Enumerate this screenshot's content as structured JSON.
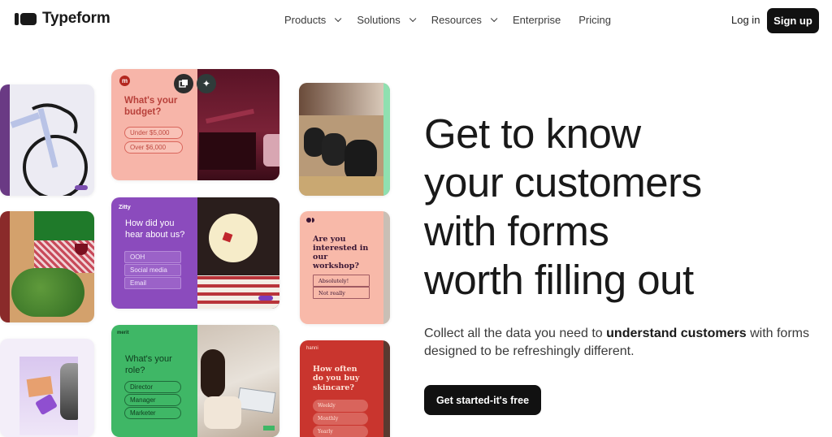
{
  "nav": {
    "brand": "Typeform",
    "menu": [
      {
        "label": "Products",
        "dropdown": true
      },
      {
        "label": "Solutions",
        "dropdown": true
      },
      {
        "label": "Resources",
        "dropdown": true
      },
      {
        "label": "Enterprise",
        "dropdown": false
      },
      {
        "label": "Pricing",
        "dropdown": false
      }
    ],
    "login": "Log in",
    "signup": "Sign up"
  },
  "hero": {
    "headline_lines": [
      "Get to know",
      "your customers",
      "with forms",
      "worth filling out"
    ],
    "sub_pre": "Collect all the data you need to ",
    "sub_bold": "understand customers",
    "sub_post": " with forms designed to be refreshingly different.",
    "cta": "Get started-it's free"
  },
  "cards": {
    "budget": {
      "brand_initial": "m",
      "question": "What's your budget?",
      "options": [
        "Under $5,000",
        "Over $6,000"
      ],
      "colors": {
        "bg": "#f7b5a9",
        "text": "#b8403a",
        "image": "#6e1a2c"
      }
    },
    "zitty": {
      "brand": "Zitty",
      "question": "How did you hear about us?",
      "options": [
        "OOH",
        "Social media",
        "Email"
      ],
      "colors": {
        "bg": "#8b4bbd",
        "text": "#ffffff"
      }
    },
    "merit": {
      "brand": "merit",
      "question": "What's your role?",
      "options": [
        "Director",
        "Manager",
        "Marketer"
      ],
      "colors": {
        "bg": "#3fb766",
        "text": "#0f3d1f"
      }
    },
    "workshop": {
      "question": "Are you interested in our workshop?",
      "options": [
        "Absolutely!",
        "Not really"
      ],
      "colors": {
        "bg": "#f8b9a9",
        "text": "#3a1634"
      }
    },
    "skincare": {
      "brand": "hanni",
      "question": "How often do you buy skincare?",
      "options": [
        "Weekly",
        "Monthly",
        "Yearly"
      ],
      "colors": {
        "bg": "#c9352e",
        "text": "#ffe3d8"
      }
    }
  }
}
